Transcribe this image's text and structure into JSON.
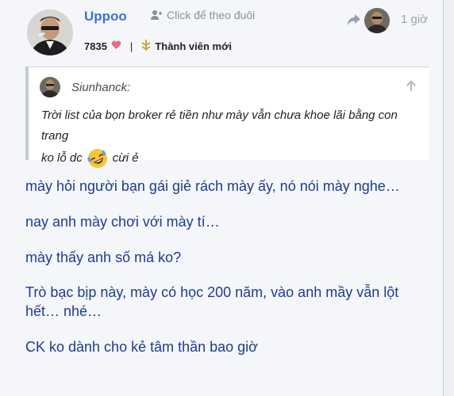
{
  "post": {
    "username": "Uppoo",
    "follow_label": "Click để theo đuôi",
    "reputation": "7835",
    "rank": "Thành viên mới",
    "time_ago": "1 giờ",
    "quote": {
      "author": "Siunhanck:",
      "text_line1": "Trời list của bọn broker rẻ tiền như mày vẫn chưa khoe lãi bằng con trang",
      "text_line2_before": "ko lỗ dc",
      "text_line2_after": "cừi ẻ",
      "emoji": "rofl-emoji"
    },
    "paragraphs": [
      "mày hỏi người bạn gái giẻ rách mày ấy, nó nói mày nghe…",
      "nay anh mày chơi với mày tí…",
      "mày thấy anh số má ko?",
      "Trò bạc bịp này, mày có học 200 năm, vào anh mầy vẫn lột hết… nhé…",
      "CK ko dành cho kẻ tâm thần bao giờ"
    ]
  },
  "colors": {
    "username": "#3d72d6",
    "body_text": "#1c3d8c",
    "heart": "#e86a8a",
    "rank_icon": "#c9a24a"
  },
  "icons": [
    "add-user-icon",
    "heart-icon",
    "rank-icon",
    "reply-arrow-icon",
    "arrow-up-icon",
    "rofl-emoji"
  ]
}
